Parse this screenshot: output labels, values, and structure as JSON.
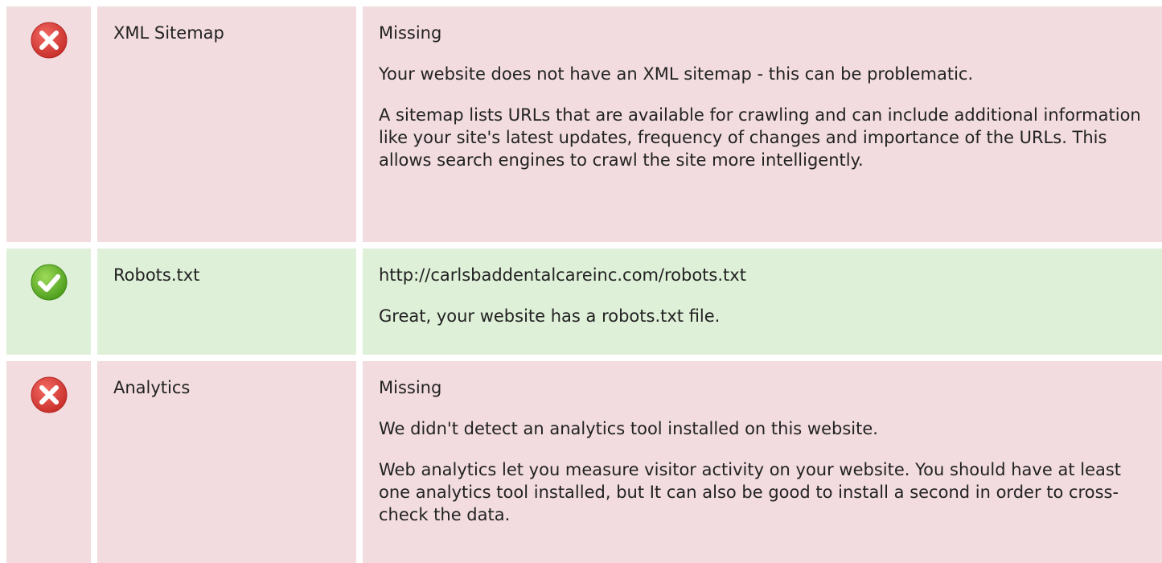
{
  "rows": [
    {
      "status": "error",
      "icon": "error-x-icon",
      "name": "XML Sitemap",
      "value": "Missing",
      "paragraphs": [
        "Your website does not have an XML sitemap - this can be problematic.",
        "A sitemap lists URLs that are available for crawling and can include additional information like your site's latest updates, frequency of changes and importance of the URLs. This allows search engines to crawl the site more intelligently."
      ]
    },
    {
      "status": "ok",
      "icon": "check-icon",
      "name": "Robots.txt",
      "value": "http://carlsbaddentalcareinc.com/robots.txt",
      "paragraphs": [
        "Great, your website has a robots.txt file."
      ]
    },
    {
      "status": "error",
      "icon": "error-x-icon",
      "name": "Analytics",
      "value": "Missing",
      "paragraphs": [
        "We didn't detect an analytics tool installed on this website.",
        "Web analytics let you measure visitor activity on your website. You should have at least one analytics tool installed, but It can also be good to install a second in order to cross-check the data."
      ]
    }
  ],
  "colors": {
    "error_bg": "#f2dcdf",
    "ok_bg": "#dff0d8",
    "error_icon": "#e0433d",
    "ok_icon": "#6cbf2c"
  }
}
